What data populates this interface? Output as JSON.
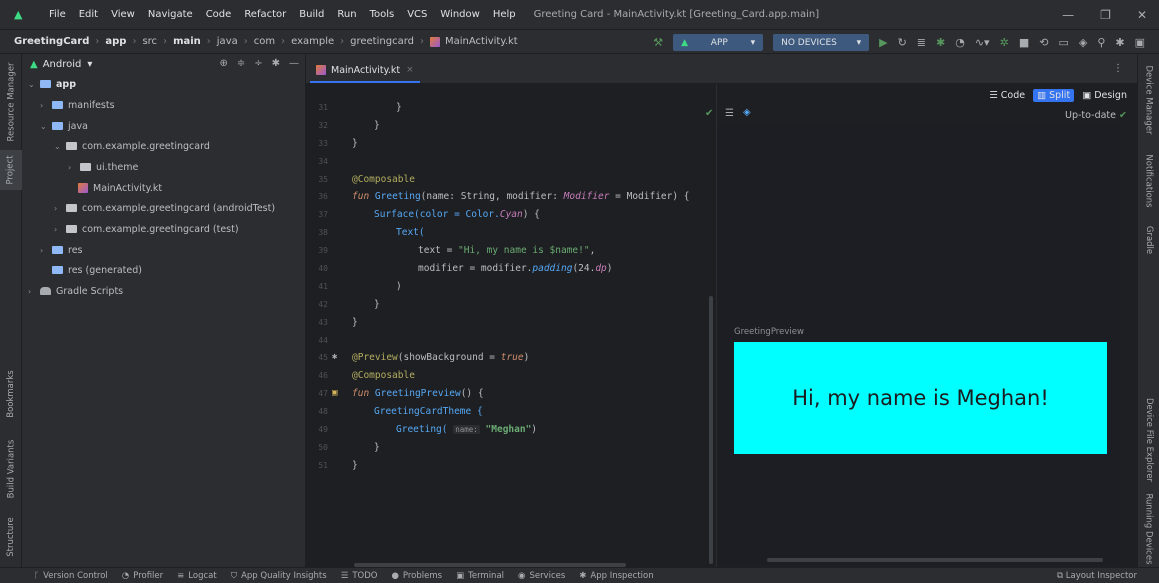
{
  "menu": {
    "items": [
      "File",
      "Edit",
      "View",
      "Navigate",
      "Code",
      "Refactor",
      "Build",
      "Run",
      "Tools",
      "VCS",
      "Window",
      "Help"
    ],
    "window_title": "Greeting Card - MainActivity.kt [Greeting_Card.app.main]"
  },
  "breadcrumb": {
    "items": [
      "GreetingCard",
      "app",
      "src",
      "main",
      "java",
      "com",
      "example",
      "greetingcard",
      "MainActivity.kt"
    ]
  },
  "toolbar": {
    "run_config": "APP",
    "device": "NO DEVICES"
  },
  "left_strip": {
    "resource_manager": "Resource Manager",
    "project": "Project",
    "bookmarks": "Bookmarks",
    "build_variants": "Build Variants",
    "structure": "Structure"
  },
  "right_strip": {
    "device_manager": "Device Manager",
    "notifications": "Notifications",
    "gradle": "Gradle",
    "device_file_explorer": "Device File Explorer",
    "running_devices": "Running Devices"
  },
  "project_panel": {
    "view_mode": "Android",
    "tree": {
      "app": "app",
      "manifests": "manifests",
      "java": "java",
      "pkg_main": "com.example.greetingcard",
      "ui_theme": "ui.theme",
      "main_activity": "MainActivity.kt",
      "pkg_android_test": "com.example.greetingcard (androidTest)",
      "pkg_test": "com.example.greetingcard (test)",
      "res": "res",
      "res_generated": "res (generated)",
      "gradle_scripts": "Gradle Scripts"
    }
  },
  "editor": {
    "tab": "MainActivity.kt",
    "line_numbers": [
      "31",
      "32",
      "33",
      "34",
      "35",
      "36",
      "37",
      "38",
      "39",
      "40",
      "41",
      "42",
      "43",
      "44",
      "45",
      "46",
      "47",
      "48",
      "49",
      "50",
      "51"
    ],
    "code": {
      "l35": "@Composable",
      "l36_fun": "fun",
      "l36_name": "Greeting",
      "l36_rest": "(name: String, modifier: ",
      "l36_mod": "Modifier",
      "l36_tail": " = Modifier) {",
      "l37_a": "Surface(color = Color.",
      "l37_b": "Cyan",
      "l37_c": ") {",
      "l38": "Text(",
      "l39_a": "text = ",
      "l39_b": "\"Hi, my name is $name!\"",
      "l39_c": ",",
      "l40_a": "modifier = modifier.",
      "l40_b": "padding",
      "l40_c": "(24.",
      "l40_d": "dp",
      "l40_e": ")",
      "l41": ")",
      "l42": "}",
      "l43": "}",
      "l45_a": "@Preview",
      "l45_b": "(showBackground = ",
      "l45_c": "true",
      "l45_d": ")",
      "l46": "@Composable",
      "l47_fun": "fun",
      "l47_name": "GreetingPreview",
      "l47_rest": "() {",
      "l48": "GreetingCardTheme {",
      "l49_a": "Greeting(",
      "l49_hint": "name:",
      "l49_str": "\"Meghan\"",
      "l49_c": ")",
      "l50": "}",
      "l51": "}",
      "brace": "}"
    }
  },
  "preview": {
    "modes": {
      "code": "Code",
      "split": "Split",
      "design": "Design"
    },
    "status": "Up-to-date",
    "label": "GreetingPreview",
    "rendered_text": "Hi, my name is Meghan!"
  },
  "statusbar": {
    "items": [
      "Version Control",
      "Profiler",
      "Logcat",
      "App Quality Insights",
      "TODO",
      "Problems",
      "Terminal",
      "Services",
      "App Inspection"
    ],
    "right": "Layout Inspector"
  },
  "colors": {
    "preview_bg": "#00ffff",
    "accent": "#3574f0",
    "ok_green": "#57965c"
  }
}
